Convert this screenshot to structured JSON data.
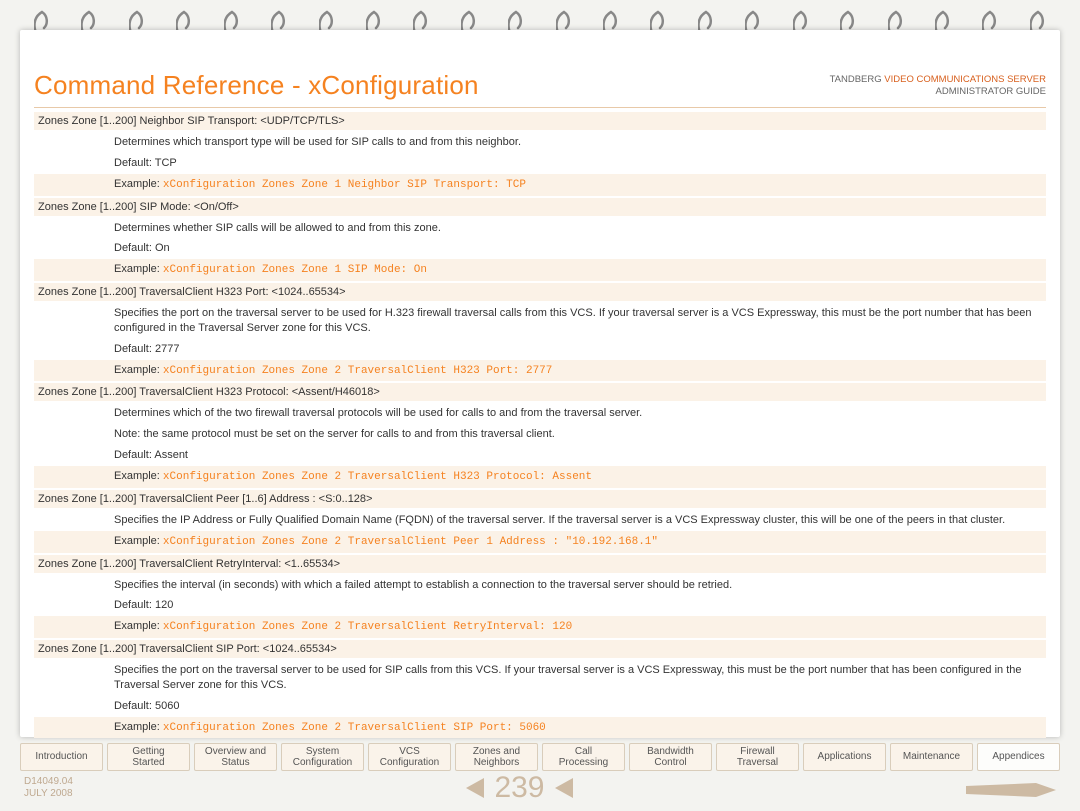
{
  "header": {
    "title": "Command Reference - xConfiguration",
    "brand_left": "TANDBERG",
    "brand_orange": "VIDEO COMMUNICATIONS SERVER",
    "subtitle": "ADMINISTRATOR GUIDE"
  },
  "commands": [
    {
      "cmd": "Zones Zone [1..200] Neighbor SIP Transport: <UDP/TCP/TLS>",
      "desc": "Determines which transport type will be used for SIP calls to and from this neighbor.",
      "default": "Default: TCP",
      "example_label": "Example:",
      "example": "xConfiguration Zones Zone 1 Neighbor SIP Transport: TCP"
    },
    {
      "cmd": "Zones Zone [1..200] SIP Mode: <On/Off>",
      "desc": "Determines whether SIP calls will be allowed to and from this zone.",
      "default": "Default: On",
      "example_label": "Example:",
      "example": "xConfiguration Zones Zone 1 SIP Mode: On"
    },
    {
      "cmd": "Zones Zone [1..200] TraversalClient H323 Port: <1024..65534>",
      "desc": "Specifies the port on the traversal server to be used for H.323 firewall traversal calls from this VCS. If your traversal server is a VCS Expressway, this must be the port number that has been configured in the Traversal Server zone for this VCS.",
      "default": "Default: 2777",
      "example_label": "Example:",
      "example": "xConfiguration Zones Zone 2 TraversalClient H323 Port: 2777"
    },
    {
      "cmd": "Zones Zone [1..200] TraversalClient H323 Protocol: <Assent/H46018>",
      "desc": "Determines which of the two firewall traversal protocols will be used for calls to and from the traversal server.",
      "note": "Note: the same protocol must be set on the server for calls to and from this traversal client.",
      "default": "Default: Assent",
      "example_label": "Example:",
      "example": "xConfiguration Zones Zone 2 TraversalClient H323 Protocol: Assent"
    },
    {
      "cmd": "Zones Zone [1..200] TraversalClient Peer [1..6] Address : <S:0..128>",
      "desc": "Specifies the IP Address or Fully Qualified Domain Name (FQDN) of the traversal server. If the traversal server is a VCS Expressway cluster, this will be one of the peers in that cluster.",
      "example_label": "Example:",
      "example": "xConfiguration Zones Zone 2 TraversalClient Peer 1 Address : \"10.192.168.1\""
    },
    {
      "cmd": "Zones Zone [1..200] TraversalClient RetryInterval: <1..65534>",
      "desc": "Specifies the interval (in seconds) with which a failed attempt to establish a connection to the traversal server should be retried.",
      "default": "Default: 120",
      "example_label": "Example:",
      "example": "xConfiguration Zones Zone 2 TraversalClient RetryInterval: 120"
    },
    {
      "cmd": "Zones Zone [1..200] TraversalClient SIP Port: <1024..65534>",
      "desc": "Specifies the port on the traversal server to be used for SIP calls from this VCS. If your traversal server is a VCS Expressway, this must be the port number that has been configured in the Traversal Server zone for this VCS.",
      "default": "Default: 5060",
      "example_label": "Example:",
      "example": "xConfiguration Zones Zone 2 TraversalClient SIP Port: 5060"
    }
  ],
  "tabs": [
    "Introduction",
    "Getting Started",
    "Overview and Status",
    "System Configuration",
    "VCS Configuration",
    "Zones and Neighbors",
    "Call Processing",
    "Bandwidth Control",
    "Firewall Traversal",
    "Applications",
    "Maintenance",
    "Appendices"
  ],
  "footer": {
    "docnum": "D14049.04",
    "date": "JULY 2008",
    "page": "239"
  }
}
